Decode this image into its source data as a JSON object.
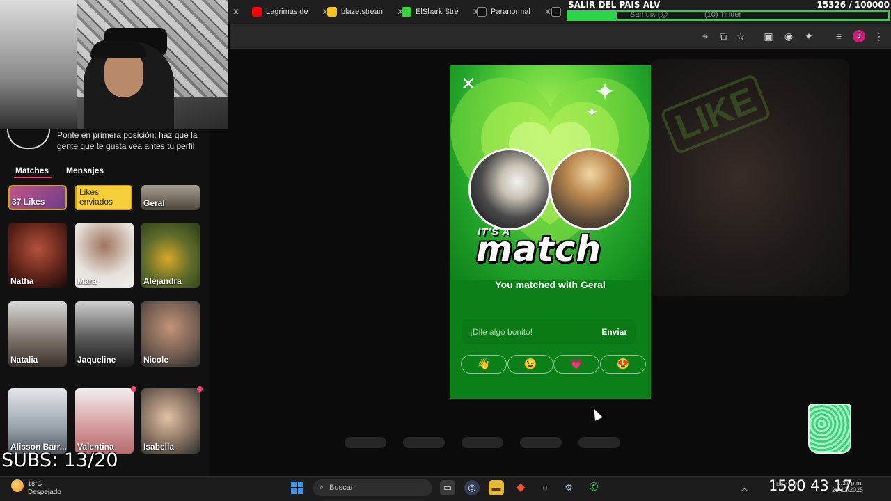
{
  "browser": {
    "tabs": [
      {
        "label": "Lagrimas de",
        "color": "#ff0000"
      },
      {
        "label": "blaze.strean",
        "color": "#f7c21a"
      },
      {
        "label": "ElShark Stre",
        "color": "#3ad23a"
      },
      {
        "label": "Paranormal",
        "color": "#111111"
      },
      {
        "label": "Samu...",
        "color": "#111111"
      },
      {
        "label": "Samuix (@",
        "color": "#444444"
      },
      {
        "label": "(10) Tinder",
        "color": "#fe3c72"
      }
    ],
    "profile_initial": "J"
  },
  "overlay": {
    "title": "SALIR DEL PAIS ALV",
    "count": "15326 / 100000",
    "progress": 0.15326,
    "accent": "#29d64a"
  },
  "left": {
    "promo_text": "Ponte en primera posición: haz que la gente que te gusta vea antes tu perfil",
    "tabs": {
      "matches": "Matches",
      "messages": "Mensajes"
    },
    "top_row": {
      "likes": "37 Likes",
      "likes_sent": "Likes enviados",
      "first_match": "Geral"
    },
    "matches": [
      {
        "name": "Natha"
      },
      {
        "name": "Mara"
      },
      {
        "name": "Alejandra"
      },
      {
        "name": "Natalia"
      },
      {
        "name": "Jaqueline"
      },
      {
        "name": "Nicole"
      },
      {
        "name": "Alisson Barr..."
      },
      {
        "name": "Valentina"
      },
      {
        "name": "Isabella"
      }
    ],
    "subs": "SUBS: 13/20"
  },
  "modal": {
    "close_icon": "close-icon",
    "tag_small": "IT'S A",
    "tag_big": "match",
    "matched_text": "You matched with Geral",
    "input_placeholder": "¡Dile algo bonito!",
    "send_label": "Enviar",
    "emojis": [
      "👋",
      "😉",
      "💗",
      "😍"
    ]
  },
  "taskbar": {
    "weather_temp": "18°C",
    "weather_desc": "Despejado",
    "search_label": "Buscar",
    "timer": "1580 43 17",
    "clock_time": "1:37 p.m.",
    "clock_date": "26/12/2025",
    "tray_lang": "ESP LAA"
  }
}
